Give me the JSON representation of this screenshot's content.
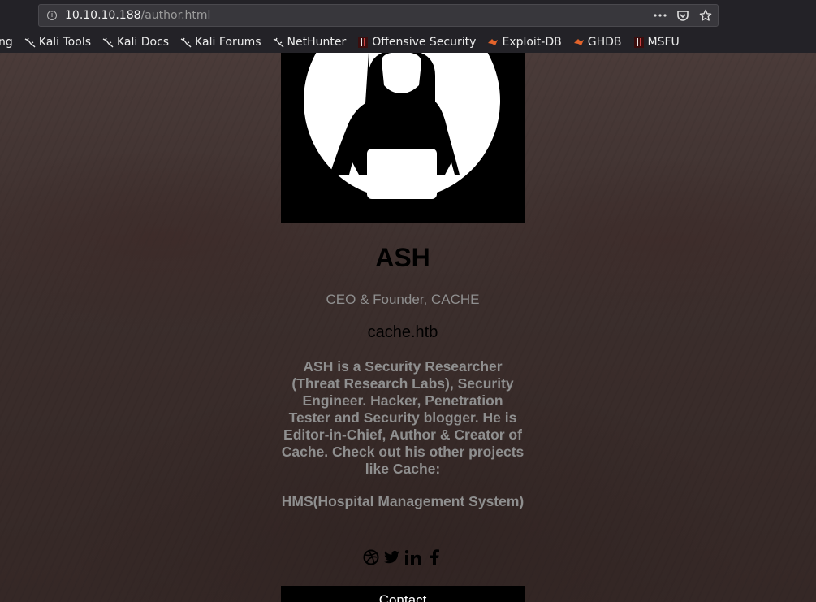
{
  "browser": {
    "url_host": "10.10.10.188",
    "url_path": "/author.html",
    "bookmarks": [
      {
        "label": "ng",
        "icon": "none"
      },
      {
        "label": "Kali Tools",
        "icon": "kali-dragon-icon"
      },
      {
        "label": "Kali Docs",
        "icon": "kali-dragon-icon"
      },
      {
        "label": "Kali Forums",
        "icon": "kali-dragon-icon"
      },
      {
        "label": "NetHunter",
        "icon": "kali-dragon-icon"
      },
      {
        "label": "Offensive Security",
        "icon": "offsec-icon"
      },
      {
        "label": "Exploit-DB",
        "icon": "exploit-db-icon"
      },
      {
        "label": "GHDB",
        "icon": "exploit-db-icon"
      },
      {
        "label": "MSFU",
        "icon": "offsec-icon"
      }
    ]
  },
  "author": {
    "name": "ASH",
    "role": "CEO & Founder, CACHE",
    "site": "cache.htb",
    "bio": "ASH is a Security Researcher (Threat Research Labs), Security Engineer. Hacker, Penetration Tester and Security blogger. He is Editor-in-Chief, Author & Creator of Cache. Check out his other projects like Cache:",
    "project": "HMS(Hospital Management System)",
    "contact_label": "Contact"
  },
  "colors": {
    "page_background": "#3b2e2c",
    "muted_text": "#8f8f8f",
    "heading_text": "#000000"
  }
}
